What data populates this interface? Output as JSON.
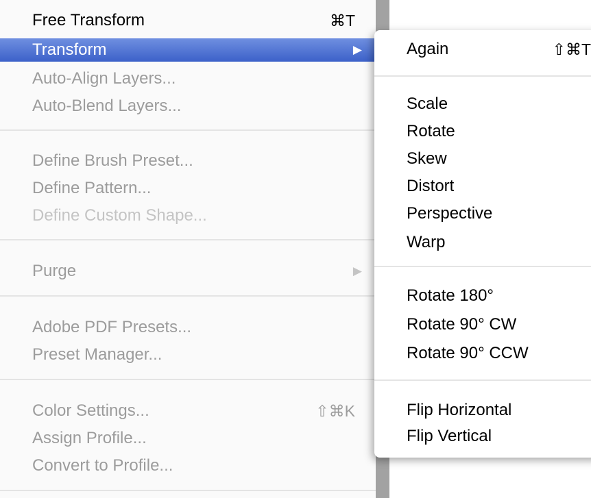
{
  "main_menu": {
    "items": [
      {
        "label": "Free Transform",
        "shortcut": "⌘T",
        "state": "enabled"
      },
      {
        "label": "Transform",
        "submenu_arrow": "▶",
        "state": "highlighted"
      },
      {
        "label": "Auto-Align Layers...",
        "state": "disabled"
      },
      {
        "label": "Auto-Blend Layers...",
        "state": "disabled"
      },
      {
        "label": "Define Brush Preset...",
        "state": "disabled"
      },
      {
        "label": "Define Pattern...",
        "state": "disabled"
      },
      {
        "label": "Define Custom Shape...",
        "state": "disabled"
      },
      {
        "label": "Purge",
        "submenu_arrow": "▶",
        "state": "disabled"
      },
      {
        "label": "Adobe PDF Presets...",
        "state": "disabled"
      },
      {
        "label": "Preset Manager...",
        "state": "disabled"
      },
      {
        "label": "Color Settings...",
        "shortcut": "⇧⌘K",
        "state": "disabled"
      },
      {
        "label": "Assign Profile...",
        "state": "disabled"
      },
      {
        "label": "Convert to Profile...",
        "state": "disabled"
      }
    ]
  },
  "transform_submenu": {
    "items": [
      {
        "label": "Again",
        "shortcut": "⇧⌘T"
      },
      {
        "label": "Scale"
      },
      {
        "label": "Rotate"
      },
      {
        "label": "Skew"
      },
      {
        "label": "Distort"
      },
      {
        "label": "Perspective"
      },
      {
        "label": "Warp"
      },
      {
        "label": "Rotate 180°"
      },
      {
        "label": "Rotate 90° CW"
      },
      {
        "label": "Rotate 90° CCW"
      },
      {
        "label": "Flip Horizontal"
      },
      {
        "label": "Flip Vertical"
      }
    ]
  },
  "colors": {
    "highlight": "#3c61c9",
    "disabled_text": "#9c9c9c",
    "separator": "#e4e4e4"
  }
}
